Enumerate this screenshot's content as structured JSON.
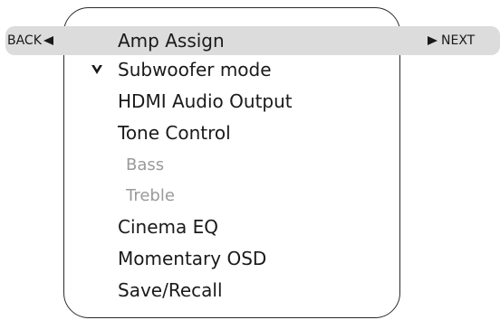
{
  "nav": {
    "back_label": "BACK",
    "next_label": "NEXT"
  },
  "menu": {
    "items": [
      {
        "label": "Amp Assign",
        "selected": true,
        "enabled": true
      },
      {
        "label": "Subwoofer mode",
        "checked": true,
        "enabled": true
      },
      {
        "label": "HDMI Audio Output",
        "enabled": true
      },
      {
        "label": "Tone Control",
        "enabled": true
      },
      {
        "label": "Bass",
        "enabled": false
      },
      {
        "label": "Treble",
        "enabled": false
      },
      {
        "label": "Cinema EQ",
        "enabled": true
      },
      {
        "label": "Momentary OSD",
        "enabled": true
      },
      {
        "label": "Save/Recall",
        "enabled": true
      }
    ]
  },
  "icons": {
    "check": "chevron-down-check-icon",
    "back_arrow": "arrow-left-icon",
    "next_arrow": "arrow-right-icon"
  },
  "colors": {
    "highlight": "#dcdcdc",
    "text": "#1a1a1a",
    "disabled_text": "#9a9a9a",
    "border": "#2b2b2b"
  }
}
